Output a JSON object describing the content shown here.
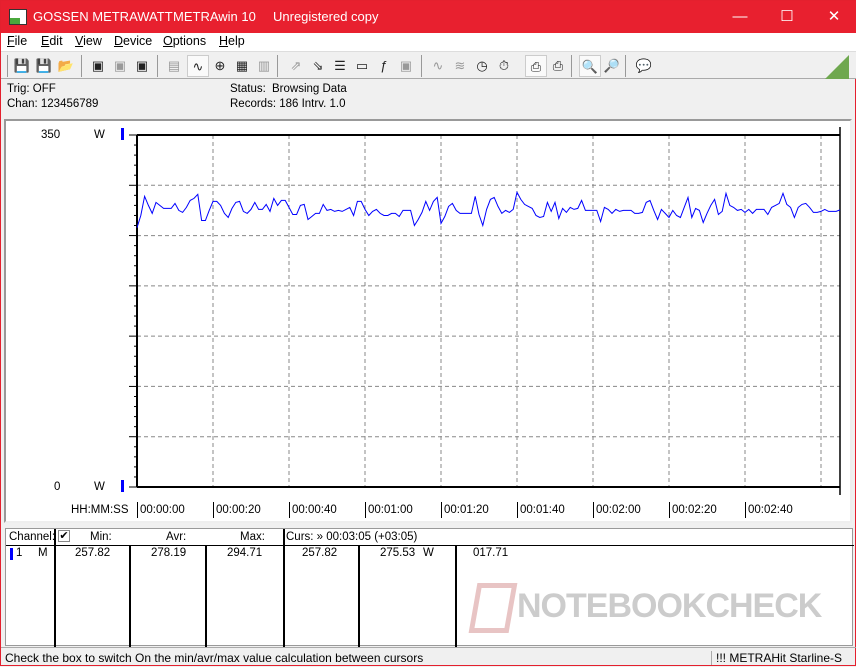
{
  "window": {
    "brand": "GOSSEN METRAWATT",
    "app": "METRAwin 10",
    "license": "Unregistered copy",
    "minimize": "—",
    "maximize": "☐",
    "close": "✕"
  },
  "menu": [
    "File",
    "Edit",
    "View",
    "Device",
    "Options",
    "Help"
  ],
  "toolbar": {
    "icons": [
      "save-icon",
      "save-as-icon",
      "open-icon",
      "read-device-icon",
      "read-device-disabled-icon",
      "read-memory-icon",
      "display-icon",
      "waveform-view-icon",
      "crosshair-icon",
      "table-view-icon",
      "histogram-icon",
      "export-icon",
      "import-icon",
      "data-list-icon",
      "monitor-icon",
      "function-icon",
      "device-icon",
      "signal-icon",
      "signal2-icon",
      "clock-icon",
      "stopwatch-icon",
      "print-preview-icon",
      "print-icon",
      "zoom-wave-icon",
      "zoom-icon",
      "comment-icon"
    ]
  },
  "info": {
    "trig": "Trig: OFF",
    "chan": "Chan:  123456789",
    "status_label": "Status:",
    "status_value": "Browsing Data",
    "records": "Records: 186   Intrv. 1.0"
  },
  "chart_data": {
    "type": "line",
    "xlabel": "HH:MM:SS",
    "ylim": [
      0,
      350
    ],
    "ytick_labels": [
      {
        "value": "350",
        "unit": "W"
      },
      {
        "value": "0",
        "unit": "W"
      }
    ],
    "xtick_labels": [
      "00:00:00",
      "00:00:20",
      "00:00:40",
      "00:01:00",
      "00:01:20",
      "00:01:40",
      "00:02:00",
      "00:02:20",
      "00:02:40"
    ],
    "interval_s": 1,
    "grid": true,
    "color": "#0000ff",
    "values": [
      257.8,
      270,
      289,
      280,
      272,
      283,
      280,
      277,
      277,
      277,
      282,
      275,
      273,
      278,
      285,
      287,
      291,
      265,
      265,
      275,
      284,
      284,
      280,
      272,
      268,
      277,
      283,
      284,
      274,
      272,
      276,
      283,
      276,
      276,
      281,
      274,
      287,
      280,
      285,
      285,
      278,
      271,
      271,
      280,
      281,
      266,
      269,
      272,
      272,
      281,
      275,
      276,
      274,
      275,
      274,
      276,
      278,
      270,
      284,
      284,
      276,
      270,
      274,
      276,
      272,
      270,
      270,
      272,
      272,
      269,
      275,
      275,
      275,
      260,
      266,
      273,
      284,
      275,
      284,
      288,
      262,
      269,
      279,
      282,
      275,
      272,
      272,
      272,
      272,
      289,
      271,
      260,
      276,
      286,
      288,
      279,
      272,
      275,
      273,
      276,
      293,
      286,
      281,
      279,
      277,
      270,
      268,
      269,
      283,
      274,
      283,
      267,
      277,
      273,
      278,
      276,
      277,
      285,
      275,
      275,
      275,
      275,
      264,
      278,
      276,
      272,
      276,
      274,
      275,
      275,
      275,
      272,
      272,
      273,
      283,
      285,
      275,
      266,
      276,
      272,
      268,
      275,
      270,
      268,
      278,
      288,
      268,
      277,
      275,
      263,
      272,
      280,
      286,
      271,
      274,
      292,
      280,
      278,
      275,
      276,
      273,
      276,
      272,
      276,
      276,
      276,
      271,
      278,
      280,
      282,
      292,
      281,
      278,
      268,
      278,
      281,
      282,
      278,
      273,
      273,
      274,
      276,
      274,
      274,
      274,
      275.5
    ]
  },
  "table": {
    "headers": {
      "channel": "Channel:",
      "min": "Min:",
      "avr": "Avr:",
      "max": "Max:",
      "curs": "Curs: » 00:03:05 (+03:05)"
    },
    "row": {
      "num": "1",
      "mode": "M",
      "min": "257.82",
      "avr": "278.19",
      "max": "294.71",
      "curs1": "257.82",
      "curs2": "275.53",
      "unit": "W",
      "curs3": "017.71"
    },
    "checkbox_checked": true
  },
  "watermark": "NOTEBOOKCHECK",
  "status": {
    "hint": "Check the box to switch On the min/avr/max value calculation between cursors",
    "device": "!!! METRAHit Starline-S"
  }
}
